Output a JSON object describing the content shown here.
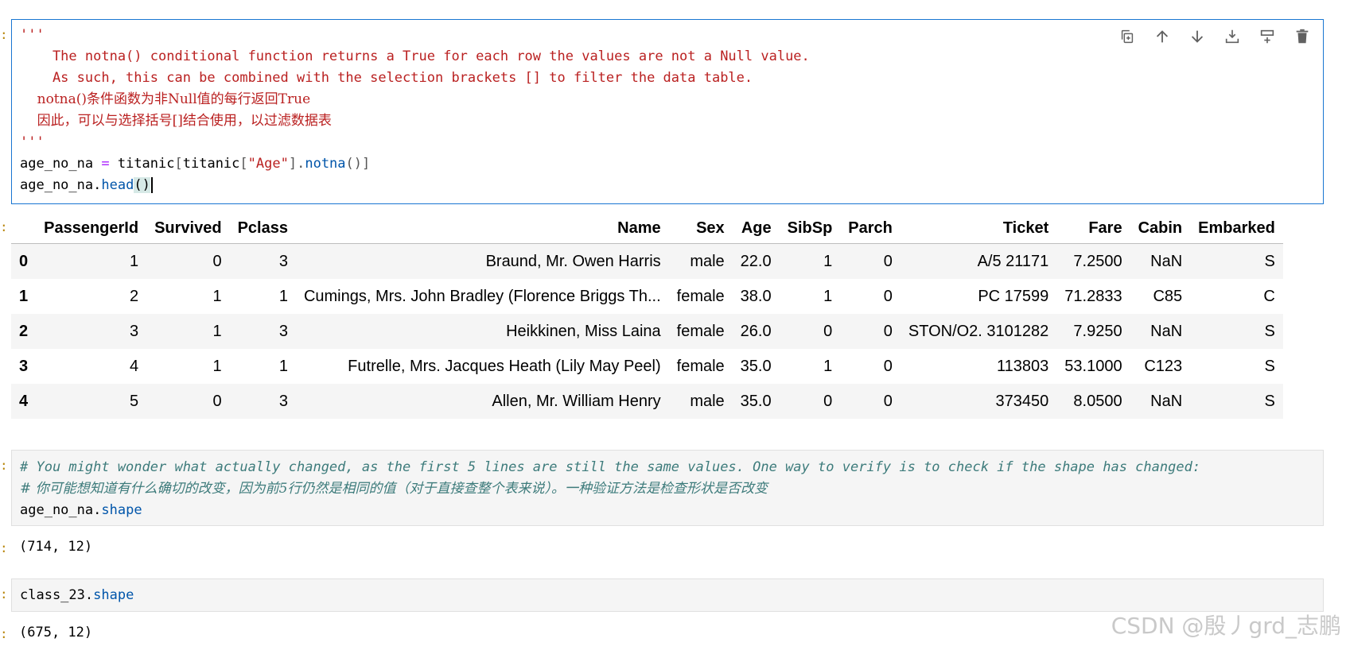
{
  "cell1": {
    "docstring_open": "'''",
    "doc_lines": [
      "    The notna() conditional function returns a True for each row the values are not a Null value.",
      "    As such, this can be combined with the selection brackets [] to filter the data table.",
      "    notna()条件函数为非Null值的每行返回True",
      "    因此，可以与选择括号[]结合使用，以过滤数据表"
    ],
    "docstring_close": "'''",
    "line1": {
      "var": "age_no_na ",
      "op": "=",
      "a": " titanic",
      "b": "[",
      "c": "titanic",
      "d": "[",
      "s": "\"Age\"",
      "e": "]",
      "f": ".",
      "fn": "notna",
      "g": "()",
      "h": "]"
    },
    "line2": {
      "var": "age_no_na",
      "dot": ".",
      "fn": "head",
      "p": "()"
    }
  },
  "toolbar": {
    "icons": [
      "copy-icon",
      "arrow-up-icon",
      "arrow-down-icon",
      "insert-above-icon",
      "insert-below-icon",
      "delete-icon"
    ]
  },
  "table": {
    "columns": [
      "",
      "PassengerId",
      "Survived",
      "Pclass",
      "Name",
      "Sex",
      "Age",
      "SibSp",
      "Parch",
      "Ticket",
      "Fare",
      "Cabin",
      "Embarked"
    ],
    "rows": [
      [
        "0",
        "1",
        "0",
        "3",
        "Braund, Mr. Owen Harris",
        "male",
        "22.0",
        "1",
        "0",
        "A/5 21171",
        "7.2500",
        "NaN",
        "S"
      ],
      [
        "1",
        "2",
        "1",
        "1",
        "Cumings, Mrs. John Bradley (Florence Briggs Th...",
        "female",
        "38.0",
        "1",
        "0",
        "PC 17599",
        "71.2833",
        "C85",
        "C"
      ],
      [
        "2",
        "3",
        "1",
        "3",
        "Heikkinen, Miss Laina",
        "female",
        "26.0",
        "0",
        "0",
        "STON/O2. 3101282",
        "7.9250",
        "NaN",
        "S"
      ],
      [
        "3",
        "4",
        "1",
        "1",
        "Futrelle, Mrs. Jacques Heath (Lily May Peel)",
        "female",
        "35.0",
        "1",
        "0",
        "113803",
        "53.1000",
        "C123",
        "S"
      ],
      [
        "4",
        "5",
        "0",
        "3",
        "Allen, Mr. William Henry",
        "male",
        "35.0",
        "0",
        "0",
        "373450",
        "8.0500",
        "NaN",
        "S"
      ]
    ]
  },
  "cell2": {
    "comment_en": "# You might wonder what actually changed, as the first 5 lines are still the same values. One way to verify is to check if the shape has changed:",
    "comment_zh": "# 你可能想知道有什么确切的改变，因为前5行仍然是相同的值（对于直接查整个表来说）。一种验证方法是检查形状是否改变",
    "code_var": "age_no_na",
    "code_dot": ".",
    "code_attr": "shape"
  },
  "output2": "(714, 12)",
  "cell3": {
    "code_var": "class_23",
    "code_dot": ".",
    "code_attr": "shape"
  },
  "output3": "(675, 12)",
  "watermark": "CSDN @殷丿grd_志鹏"
}
